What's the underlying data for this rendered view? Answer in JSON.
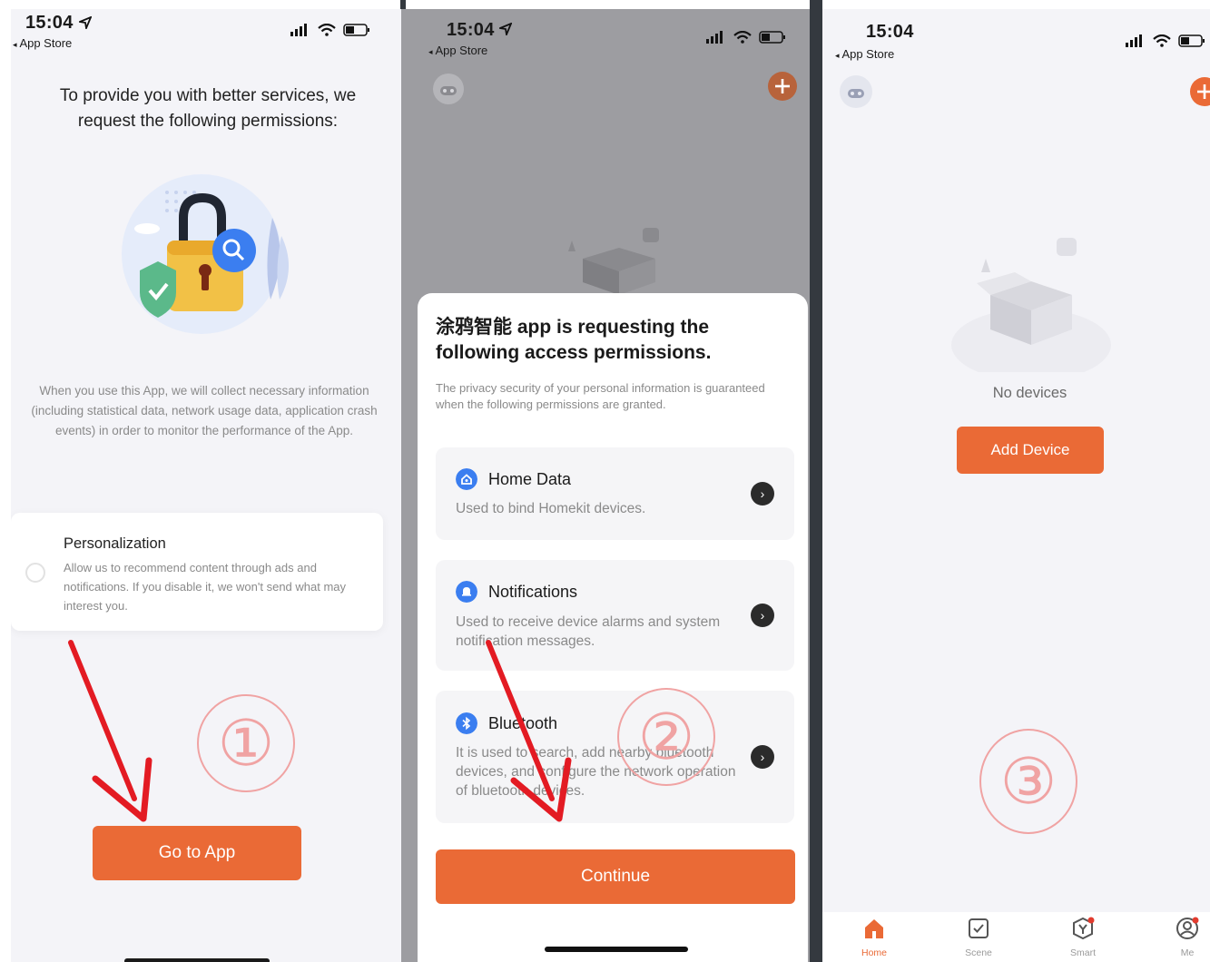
{
  "status": {
    "time": "15:04",
    "back_label": "App Store"
  },
  "screen1": {
    "title": "To provide you with better services, we request the following permissions:",
    "info": "When you use this App, we will collect necessary information (including statistical data, network usage data, application crash events) in order to monitor the performance of the App.",
    "personalization": {
      "title": "Personalization",
      "desc": "Allow us to recommend content through ads and notifications. If you disable it, we won't send what may interest you."
    },
    "button": "Go to App",
    "step": "①"
  },
  "screen2": {
    "title": "涂鸦智能 app is requesting the following access permissions.",
    "subtitle": "The privacy security of your personal information is guaranteed when the following permissions are granted.",
    "permissions": [
      {
        "title": "Home Data",
        "desc": "Used to bind Homekit devices."
      },
      {
        "title": "Notifications",
        "desc": "Used to receive device alarms and system notification messages."
      },
      {
        "title": "Bluetooth",
        "desc": "It is used to search, add nearby bluetooth devices, and configure the network operation of bluetooth devices."
      }
    ],
    "button": "Continue",
    "step": "②"
  },
  "screen3": {
    "empty_text": "No devices",
    "button": "Add Device",
    "step": "③",
    "tabs": [
      {
        "label": "Home",
        "icon": "home-icon",
        "active": true
      },
      {
        "label": "Scene",
        "icon": "scene-icon",
        "active": false
      },
      {
        "label": "Smart",
        "icon": "smart-icon",
        "active": false
      },
      {
        "label": "Me",
        "icon": "profile-icon",
        "active": false
      }
    ]
  },
  "colors": {
    "accent": "#ea6a36",
    "annotation": "#f0a3a3",
    "arrow": "#e31b23",
    "blue": "#3b7ef0"
  }
}
